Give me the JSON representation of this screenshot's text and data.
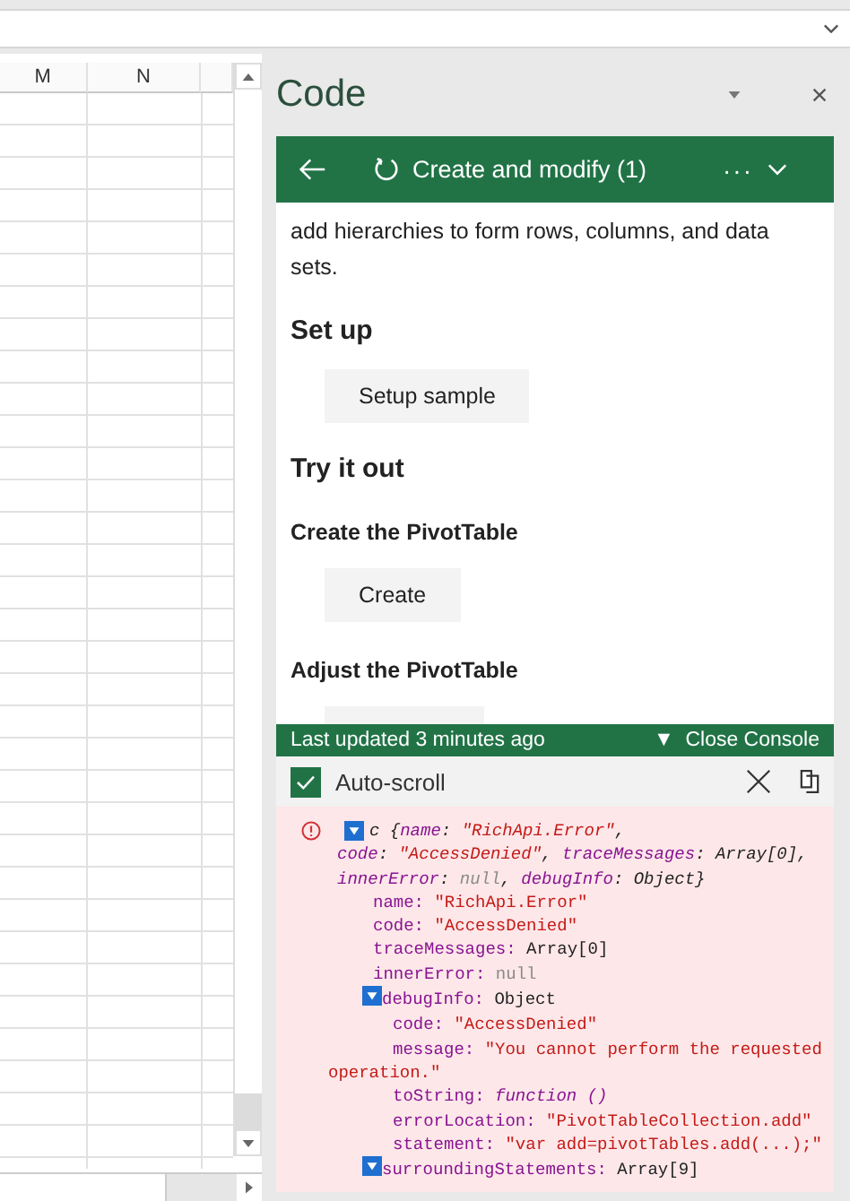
{
  "sheet": {
    "columns": [
      "M",
      "N"
    ]
  },
  "pane": {
    "title": "Code",
    "header": {
      "title": "Create and modify (1)",
      "more": "···"
    },
    "content": [
      {
        "kind": "paragraph",
        "text": "add hierarchies to form rows, columns, and data sets."
      },
      {
        "kind": "heading",
        "text": "Set up"
      },
      {
        "kind": "button",
        "text": "Setup sample"
      },
      {
        "kind": "heading",
        "text": "Try it out"
      },
      {
        "kind": "subheading",
        "text": "Create the PivotTable"
      },
      {
        "kind": "button",
        "text": "Create"
      },
      {
        "kind": "subheading",
        "text": "Adjust the PivotTable"
      },
      {
        "kind": "cut_button"
      }
    ],
    "status": {
      "updated": "Last updated 3 minutes ago",
      "toggle": "▼",
      "close": "Close Console"
    },
    "console": {
      "auto_scroll": {
        "label": "Auto-scroll",
        "checked": true
      },
      "entries": [
        {
          "kind": "error",
          "expanded": true,
          "summary": [
            [
              {
                "text": "c {",
                "kind": "plain"
              },
              {
                "text": "name",
                "kind": "key"
              },
              {
                "text": ": ",
                "kind": "plain"
              },
              {
                "text": "\"RichApi.Error\"",
                "kind": "str"
              },
              {
                "text": ",",
                "kind": "plain"
              }
            ],
            [
              {
                "text": "code",
                "kind": "key"
              },
              {
                "text": ": ",
                "kind": "plain"
              },
              {
                "text": "\"AccessDenied\"",
                "kind": "str"
              },
              {
                "text": ", ",
                "kind": "plain"
              },
              {
                "text": "traceMessages",
                "kind": "key"
              },
              {
                "text": ": Array[0],",
                "kind": "plain"
              }
            ],
            [
              {
                "text": "innerError",
                "kind": "key"
              },
              {
                "text": ": ",
                "kind": "plain"
              },
              {
                "text": "null",
                "kind": "null"
              },
              {
                "text": ", ",
                "kind": "plain"
              },
              {
                "text": "debugInfo",
                "kind": "key"
              },
              {
                "text": ": Object}",
                "kind": "plain"
              }
            ]
          ],
          "children": [
            {
              "key": "name:",
              "value": "\"RichApi.Error\"",
              "kind": "string"
            },
            {
              "key": "code:",
              "value": "\"AccessDenied\"",
              "kind": "string"
            },
            {
              "key": "traceMessages:",
              "value": "Array[0]",
              "kind": "plain"
            },
            {
              "key": "innerError:",
              "value": "null",
              "kind": "null"
            },
            {
              "key": "debugInfo:",
              "value": "Object",
              "kind": "plain",
              "expanded": true,
              "children": [
                {
                  "key": "code:",
                  "value": "\"AccessDenied\"",
                  "kind": "string"
                },
                {
                  "key": "message:",
                  "value": "\"You cannot perform the requested operation.\"",
                  "kind": "string"
                },
                {
                  "key": "toString:",
                  "value": "function ()",
                  "kind": "function"
                },
                {
                  "key": "errorLocation:",
                  "value": "\"PivotTableCollection.add\"",
                  "kind": "string"
                },
                {
                  "key": "statement:",
                  "value": "\"var add=pivotTables.add(...);\"",
                  "kind": "string"
                }
              ]
            },
            {
              "key": "surroundingStatements:",
              "value": "Array[9]",
              "kind": "plain",
              "expanded": true
            }
          ]
        }
      ]
    }
  }
}
